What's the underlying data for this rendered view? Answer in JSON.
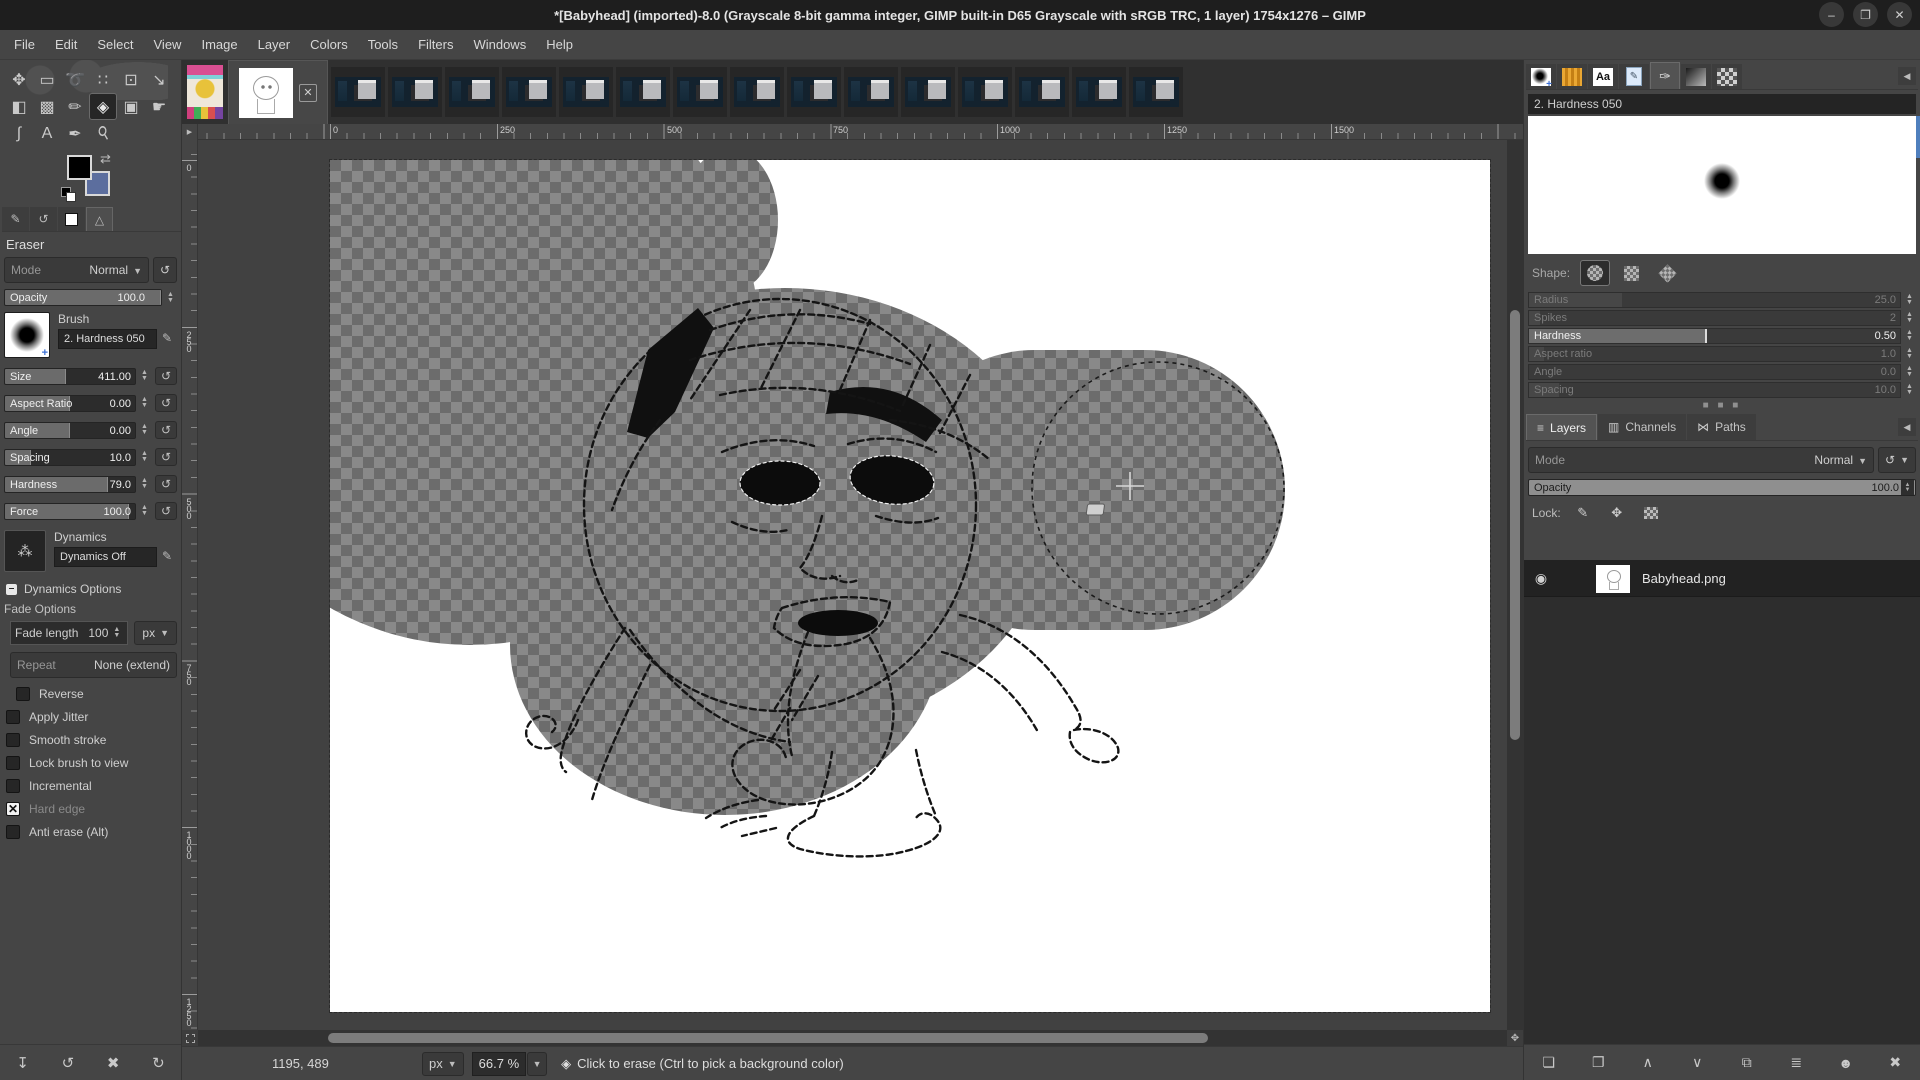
{
  "title_bar": {
    "title": "*[Babyhead] (imported)-8.0 (Grayscale 8-bit gamma integer, GIMP built-in D65 Grayscale with sRGB TRC, 1 layer) 1754x1276 – GIMP",
    "minimize_glyph": "–",
    "maximize_glyph": "❐",
    "close_glyph": "✕"
  },
  "menu": {
    "items": [
      "File",
      "Edit",
      "Select",
      "View",
      "Image",
      "Layer",
      "Colors",
      "Tools",
      "Filters",
      "Windows",
      "Help"
    ]
  },
  "toolbox": {
    "tools": [
      {
        "name": "move",
        "glyph": "✥"
      },
      {
        "name": "rectangle-select",
        "glyph": "▭"
      },
      {
        "name": "free-select",
        "glyph": "➰"
      },
      {
        "name": "fuzzy-select",
        "glyph": "∷"
      },
      {
        "name": "crop",
        "glyph": "⊡"
      },
      {
        "name": "transform",
        "glyph": "↘"
      },
      {
        "name": "bucket-fill",
        "glyph": "◧"
      },
      {
        "name": "gradient",
        "glyph": "▩"
      },
      {
        "name": "pencil",
        "glyph": "✏"
      },
      {
        "name": "eraser",
        "glyph": "◈"
      },
      {
        "name": "clone",
        "glyph": "▣"
      },
      {
        "name": "smudge",
        "glyph": "☛"
      },
      {
        "name": "paths",
        "glyph": "∫"
      },
      {
        "name": "text",
        "glyph": "A"
      },
      {
        "name": "color-picker",
        "glyph": "✒"
      },
      {
        "name": "zoom",
        "glyph": "⚲"
      }
    ],
    "foreground_color": "#000000",
    "background_color": "#5c6e9e",
    "swap_glyph": "⇄"
  },
  "dialog_tabs": [
    {
      "name": "tool-options-icon",
      "glyph": "✎"
    },
    {
      "name": "undo-history-icon",
      "glyph": "↺"
    },
    {
      "name": "image-thumbnail",
      "glyph": ""
    },
    {
      "name": "easel-icon",
      "glyph": "△"
    }
  ],
  "tool_options": {
    "title": "Eraser",
    "mode_label": "Mode",
    "mode_value": "Normal",
    "opacity_label": "Opacity",
    "opacity_value": "100.0",
    "brush_label": "Brush",
    "brush_name": "2. Hardness 050",
    "sliders": [
      {
        "label": "Size",
        "value": "411.00",
        "fill": 47
      },
      {
        "label": "Aspect Ratio",
        "value": "0.00",
        "fill": 50
      },
      {
        "label": "Angle",
        "value": "0.00",
        "fill": 50
      },
      {
        "label": "Spacing",
        "value": "10.0",
        "fill": 20
      },
      {
        "label": "Hardness",
        "value": "79.0",
        "fill": 79
      },
      {
        "label": "Force",
        "value": "100.0",
        "fill": 95
      }
    ],
    "dynamics_label": "Dynamics",
    "dynamics_value": "Dynamics Off",
    "dynamics_options_label": "Dynamics Options",
    "fade_options_label": "Fade Options",
    "fade_length_label": "Fade length",
    "fade_length_value": "100",
    "fade_unit": "px",
    "repeat_label": "Repeat",
    "repeat_value": "None (extend)",
    "checkboxes": [
      {
        "label": "Reverse",
        "checked": false
      },
      {
        "label": "Apply Jitter",
        "checked": false
      },
      {
        "label": "Smooth stroke",
        "checked": false
      },
      {
        "label": "Lock brush to view",
        "checked": false
      },
      {
        "label": "Incremental",
        "checked": false
      },
      {
        "label": "Hard edge",
        "checked": true
      },
      {
        "label": "Anti erase  (Alt)",
        "checked": false
      }
    ]
  },
  "canvas": {
    "h_ruler_labels": [
      "0",
      "250",
      "500",
      "750",
      "1000",
      "1250",
      "1500"
    ],
    "v_ruler_labels": [
      "0",
      "250",
      "500",
      "750",
      "1000",
      "1250"
    ]
  },
  "status_bar": {
    "position": "1195, 489",
    "unit": "px",
    "zoom": "66.7 %",
    "message": "Click to erase (Ctrl to pick a background color)"
  },
  "brush_editor": {
    "header": "2. Hardness 050",
    "shape_label": "Shape:",
    "sliders": [
      {
        "label": "Radius",
        "value": "25.0",
        "fill": 25
      },
      {
        "label": "Spikes",
        "value": "2",
        "fill": 3
      },
      {
        "label": "Hardness",
        "value": "0.50",
        "fill": 48
      },
      {
        "label": "Aspect ratio",
        "value": "1.0",
        "fill": 4
      },
      {
        "label": "Angle",
        "value": "0.0",
        "fill": 0
      },
      {
        "label": "Spacing",
        "value": "10.0",
        "fill": 8
      }
    ]
  },
  "layers_panel": {
    "tabs": [
      "Layers",
      "Channels",
      "Paths"
    ],
    "tab_glyphs": [
      "≡",
      "▥",
      "⋈"
    ],
    "mode_label": "Mode",
    "mode_value": "Normal",
    "opacity_label": "Opacity",
    "opacity_value": "100.0",
    "lock_label": "Lock:",
    "layer": {
      "name": "Babyhead.png"
    }
  }
}
